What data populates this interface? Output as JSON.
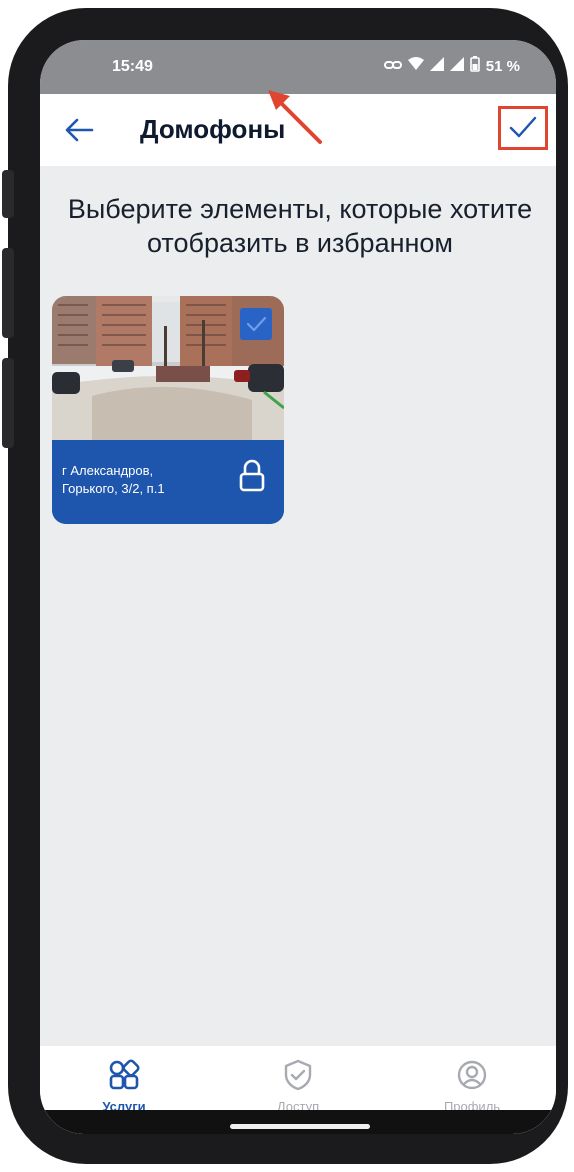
{
  "status_bar": {
    "time": "15:49",
    "battery": "51 %"
  },
  "app_bar": {
    "title": "Домофоны",
    "back_icon": "arrow-left-icon",
    "confirm_icon": "checkmark-icon",
    "highlight_color": "#e0462f"
  },
  "main": {
    "prompt": "Выберите элементы, которые хотите отобразить в избранном",
    "cards": [
      {
        "address_line1": "г Александров,",
        "address_line2": "Горького, 3/2, п.1",
        "selected": true,
        "lock_icon": "lock-icon"
      }
    ]
  },
  "bottom_nav": {
    "items": [
      {
        "label": "Услуги",
        "icon": "services-grid-icon",
        "active": true
      },
      {
        "label": "Доступ",
        "icon": "shield-check-icon",
        "active": false
      },
      {
        "label": "Профиль",
        "icon": "profile-icon",
        "active": false
      }
    ]
  },
  "colors": {
    "brand_blue": "#1f56ad",
    "background": "#ebedef",
    "inactive": "#a7aab0"
  }
}
